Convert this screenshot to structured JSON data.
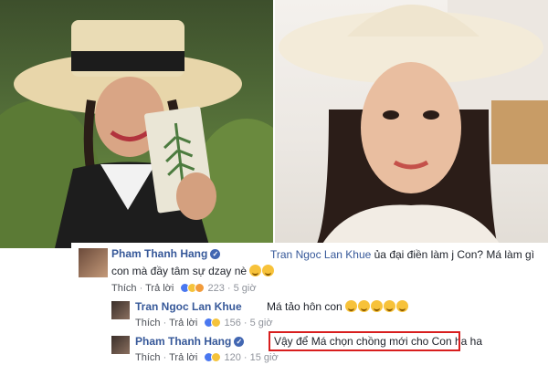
{
  "comments": [
    {
      "author": "Pham Thanh Hang",
      "verified": true,
      "mention": "Tran Ngoc Lan Khue",
      "text_line1": " ủa đại điền làm j Con? Má làm gì",
      "text_line2": "con mà đầy tâm sự dzay nè",
      "like_label": "Thích",
      "reply_label": "Trả lời",
      "reaction_count": "223",
      "time": "5 giờ"
    },
    {
      "author": "Tran Ngoc Lan Khue",
      "verified": false,
      "text": "Má tảo hôn con",
      "like_label": "Thích",
      "reply_label": "Trả lời",
      "reaction_count": "156",
      "time": "5 giờ"
    },
    {
      "author": "Pham Thanh Hang",
      "verified": true,
      "text": "Vậy để Má chọn chồng mới cho Con ha ha",
      "like_label": "Thích",
      "reply_label": "Trả lời",
      "reaction_count": "120",
      "time": "15 giờ"
    }
  ],
  "colors": {
    "name_link": "#365899",
    "highlight_border": "#d81e1e",
    "meta_text": "#90949c"
  }
}
